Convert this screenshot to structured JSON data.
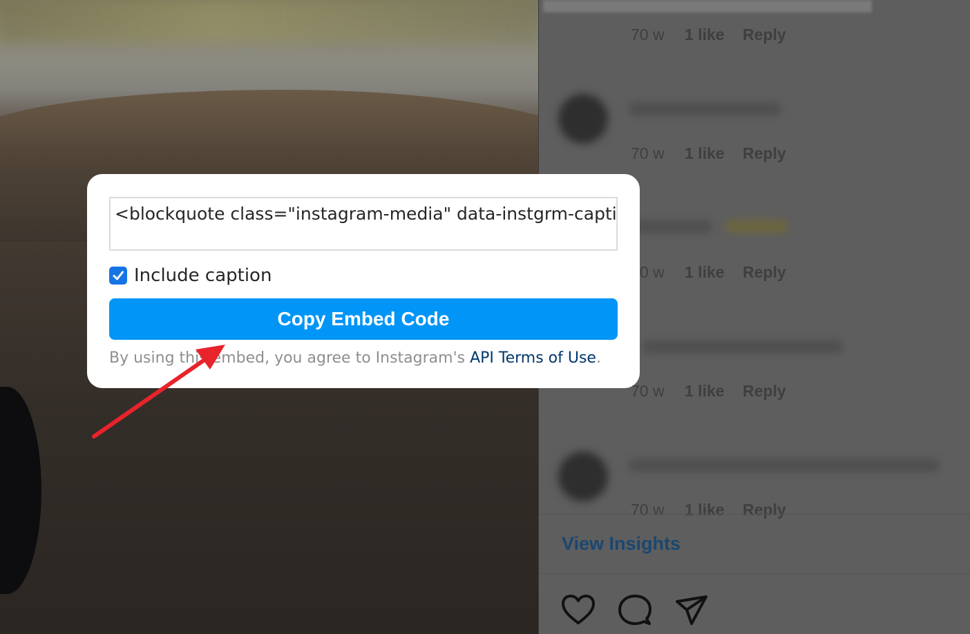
{
  "comments_panel": {
    "comments": [
      {
        "time_ago": "70 w",
        "likes": "1 like",
        "reply": "Reply"
      },
      {
        "time_ago": "70 w",
        "likes": "1 like",
        "reply": "Reply"
      },
      {
        "time_ago": "0 w",
        "likes": "1 like",
        "reply": "Reply"
      },
      {
        "time_ago": "70 w",
        "likes": "1 like",
        "reply": "Reply"
      },
      {
        "time_ago": "70 w",
        "likes": "1 like",
        "reply": "Reply"
      }
    ],
    "view_insights": "View Insights",
    "action_icons": [
      "heart-icon",
      "comment-icon",
      "share-icon"
    ]
  },
  "embed_modal": {
    "code_text": "<blockquote class=\"instagram-media\" data-instgrm-captioned data-instgrm-permalink",
    "include_caption_label": "Include caption",
    "include_caption_checked": true,
    "copy_button_label": "Copy Embed Code",
    "terms_prefix": "By using this embed, you agree to Instagram's ",
    "terms_link": "API Terms of Use",
    "terms_suffix": "."
  },
  "colors": {
    "primary_button": "#0095f6",
    "checkbox": "#1774e4",
    "link": "#00376b",
    "annotation_arrow": "#e8232b"
  }
}
